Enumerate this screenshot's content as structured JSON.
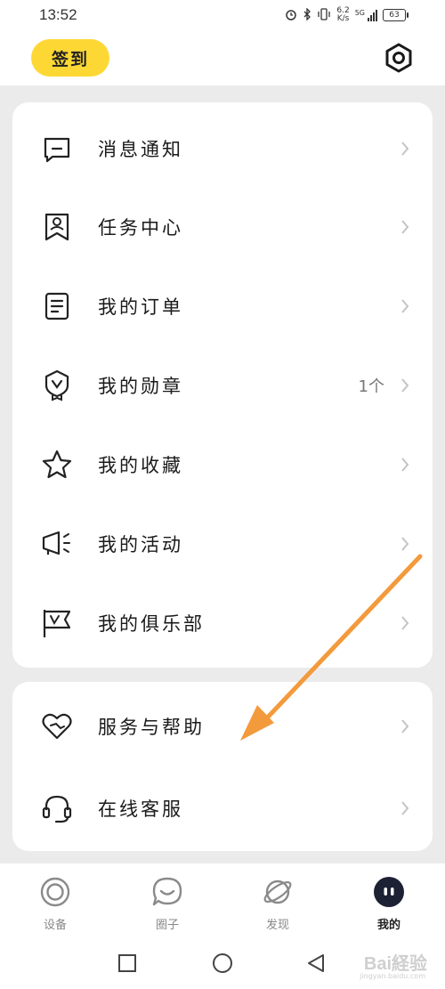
{
  "status_bar": {
    "time": "13:52",
    "speed_top": "6.2",
    "speed_bottom": "K/s",
    "network": "5G",
    "battery": "63"
  },
  "header": {
    "checkin_label": "签到"
  },
  "menu_main": [
    {
      "label": "消息通知",
      "icon": "message-icon",
      "count": ""
    },
    {
      "label": "任务中心",
      "icon": "task-badge-icon",
      "count": ""
    },
    {
      "label": "我的订单",
      "icon": "order-document-icon",
      "count": ""
    },
    {
      "label": "我的勋章",
      "icon": "medal-icon",
      "count": "1个"
    },
    {
      "label": "我的收藏",
      "icon": "star-icon",
      "count": ""
    },
    {
      "label": "我的活动",
      "icon": "megaphone-icon",
      "count": ""
    },
    {
      "label": "我的俱乐部",
      "icon": "club-flag-icon",
      "count": ""
    }
  ],
  "menu_secondary": [
    {
      "label": "服务与帮助",
      "icon": "heart-help-icon"
    },
    {
      "label": "在线客服",
      "icon": "headset-icon"
    }
  ],
  "bottom_nav": [
    {
      "label": "设备",
      "icon": "device-icon",
      "active": false
    },
    {
      "label": "圈子",
      "icon": "community-icon",
      "active": false
    },
    {
      "label": "发现",
      "icon": "planet-icon",
      "active": false
    },
    {
      "label": "我的",
      "icon": "profile-icon",
      "active": true
    }
  ],
  "watermark": {
    "text": "Bai経验",
    "sub": "jingyan.baidu.com"
  },
  "colors": {
    "accent_yellow": "#fdd835",
    "arrow_orange": "#f39a3c",
    "background": "#ebebeb"
  }
}
